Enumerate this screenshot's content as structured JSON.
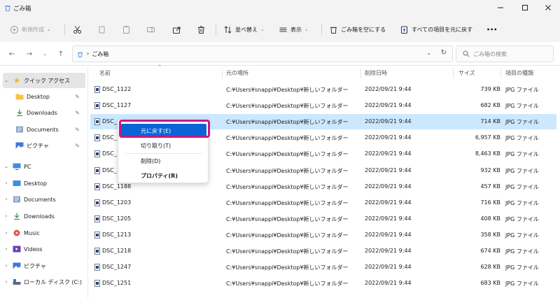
{
  "window": {
    "title": "ごみ箱",
    "controls": {
      "minimize": "minimize",
      "maximize": "maximize",
      "close": "close"
    }
  },
  "toolbar": {
    "new_label": "新規作成",
    "sort_label": "並べ替え",
    "view_label": "表示",
    "empty_recycle_label": "ごみ箱を空にする",
    "restore_all_label": "すべての項目を元に戻す",
    "more_label": "•••"
  },
  "address": {
    "crumb_location": "ごみ箱",
    "search_placeholder": "ごみ箱の検索"
  },
  "sidebar": {
    "quick_access": "クイック アクセス",
    "quick_items": [
      {
        "label": "Desktop",
        "icon": "folder-icon"
      },
      {
        "label": "Downloads",
        "icon": "download-icon"
      },
      {
        "label": "Documents",
        "icon": "documents-icon"
      },
      {
        "label": "ピクチャ",
        "icon": "pictures-icon"
      }
    ],
    "pc": "PC",
    "pc_items": [
      {
        "label": "Desktop",
        "icon": "desktop-icon"
      },
      {
        "label": "Documents",
        "icon": "documents-icon"
      },
      {
        "label": "Downloads",
        "icon": "download-icon"
      },
      {
        "label": "Music",
        "icon": "music-icon"
      },
      {
        "label": "Videos",
        "icon": "videos-icon"
      },
      {
        "label": "ピクチャ",
        "icon": "pictures-icon"
      },
      {
        "label": "ローカル ディスク (C:)",
        "icon": "drive-icon"
      }
    ]
  },
  "columns": {
    "name": "名前",
    "original_location": "元の場所",
    "date_deleted": "削除日時",
    "size": "サイズ",
    "item_type": "項目の種類"
  },
  "files": [
    {
      "name": "DSC_1122",
      "location": "C:¥Users¥snappi¥Desktop¥新しいフォルダー",
      "date": "2022/09/21 9:44",
      "size": "739 KB",
      "type": "JPG ファイル"
    },
    {
      "name": "DSC_1127",
      "location": "C:¥Users¥snappi¥Desktop¥新しいフォルダー",
      "date": "2022/09/21 9:44",
      "size": "682 KB",
      "type": "JPG ファイル"
    },
    {
      "name": "DSC_",
      "location": "C:¥Users¥snappi¥Desktop¥新しいフォルダー",
      "date": "2022/09/21 9:44",
      "size": "714 KB",
      "type": "JPG ファイル"
    },
    {
      "name": "DSC_1",
      "location": "C:¥Users¥snappi¥Desktop¥新しいフォルダー",
      "date": "2022/09/21 9:44",
      "size": "6,957 KB",
      "type": "JPG ファイル"
    },
    {
      "name": "DSC_11",
      "location": "C:¥Users¥snappi¥Desktop¥新しいフォルダー",
      "date": "2022/09/21 9:44",
      "size": "8,463 KB",
      "type": "JPG ファイル"
    },
    {
      "name": "DSC_11",
      "location": "C:¥Users¥snappi¥Desktop¥新しいフォルダー",
      "date": "2022/09/21 9:44",
      "size": "932 KB",
      "type": "JPG ファイル"
    },
    {
      "name": "DSC_1188",
      "location": "C:¥Users¥snappi¥Desktop¥新しいフォルダー",
      "date": "2022/09/21 9:44",
      "size": "457 KB",
      "type": "JPG ファイル"
    },
    {
      "name": "DSC_1203",
      "location": "C:¥Users¥snappi¥Desktop¥新しいフォルダー",
      "date": "2022/09/21 9:44",
      "size": "716 KB",
      "type": "JPG ファイル"
    },
    {
      "name": "DSC_1205",
      "location": "C:¥Users¥snappi¥Desktop¥新しいフォルダー",
      "date": "2022/09/21 9:44",
      "size": "408 KB",
      "type": "JPG ファイル"
    },
    {
      "name": "DSC_1213",
      "location": "C:¥Users¥snappi¥Desktop¥新しいフォルダー",
      "date": "2022/09/21 9:44",
      "size": "358 KB",
      "type": "JPG ファイル"
    },
    {
      "name": "DSC_1218",
      "location": "C:¥Users¥snappi¥Desktop¥新しいフォルダー",
      "date": "2022/09/21 9:44",
      "size": "674 KB",
      "type": "JPG ファイル"
    },
    {
      "name": "DSC_1247",
      "location": "C:¥Users¥snappi¥Desktop¥新しいフォルダー",
      "date": "2022/09/21 9:44",
      "size": "628 KB",
      "type": "JPG ファイル"
    },
    {
      "name": "DSC_1251",
      "location": "C:¥Users¥snappi¥Desktop¥新しいフォルダー",
      "date": "2022/09/21 9:44",
      "size": "683 KB",
      "type": "JPG ファイル"
    }
  ],
  "selected_row": 2,
  "context_menu": {
    "restore": "元に戻す(E)",
    "cut": "切り取り(T)",
    "delete": "削除(D)",
    "properties": "プロパティ(R)"
  },
  "colors": {
    "accent": "#0a64d8",
    "selection": "#cce8ff",
    "highlight_frame": "#c8197f",
    "chrome": "#f3f3f3"
  }
}
